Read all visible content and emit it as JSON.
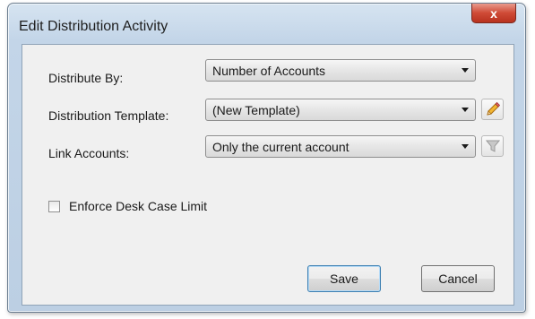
{
  "window": {
    "title": "Edit Distribution Activity",
    "close_glyph": "x"
  },
  "form": {
    "distribute_by": {
      "label": "Distribute By:",
      "value": "Number of Accounts"
    },
    "distribution_template": {
      "label": "Distribution Template:",
      "value": "(New Template)",
      "edit_icon": "pencil-icon"
    },
    "link_accounts": {
      "label": "Link Accounts:",
      "value": "Only the current account",
      "filter_icon": "funnel-icon"
    },
    "enforce_limit": {
      "label": "Enforce Desk Case Limit",
      "checked": false
    }
  },
  "buttons": {
    "save": "Save",
    "cancel": "Cancel"
  }
}
